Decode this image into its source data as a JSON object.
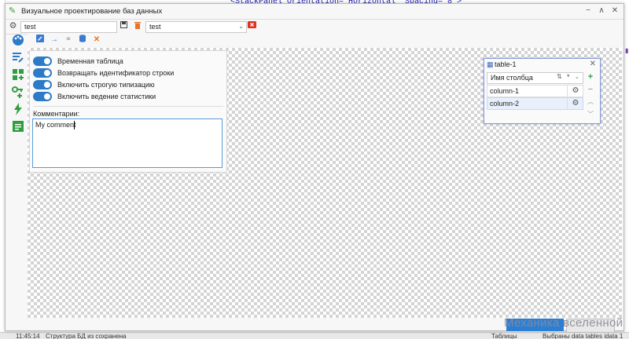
{
  "background": {
    "code_line": "<StackPanel Orientation=\"Horizontal\" Spacing=\"8\">",
    "watermark": "Механика вселенной",
    "status_time": "11:45:14",
    "status_text": "Структура БД из сохранена",
    "status_right_1": "Таблицы",
    "status_right_2": "Выбраны data tables idata 1"
  },
  "dialog": {
    "title": "Визуальное проектирование баз данных",
    "window_buttons": [
      "−",
      "∧",
      "✕"
    ]
  },
  "toolbar": {
    "project_value": "test",
    "schema_value": "test"
  },
  "properties": {
    "toggles": [
      {
        "label": "Временная таблица",
        "on": true
      },
      {
        "label": "Возвращать идентификатор строки",
        "on": true
      },
      {
        "label": "Включить строгую типизацию",
        "on": true
      },
      {
        "label": "Включить ведение статистики",
        "on": true
      }
    ],
    "comment_label": "Комментарии:",
    "comment_value": "My comment"
  },
  "table_window": {
    "title": "table-1",
    "column_header": "Имя столбца",
    "columns": [
      "column-1",
      "column-2"
    ]
  },
  "colors": {
    "accent": "#2b7bc9",
    "delete": "#e0301e",
    "add": "#2f9e3f",
    "warn": "#e8742a"
  },
  "icons": [
    "gear-icon",
    "save-icon",
    "trash-icon",
    "remove-icon",
    "edit-icon",
    "arrow-right-icon",
    "link-icon",
    "database-icon",
    "close-icon",
    "palette-icon",
    "list-edit-icon",
    "grid-add-icon",
    "key-add-icon",
    "lightning-icon",
    "comment-icon",
    "table-icon",
    "plus-icon",
    "minus-icon",
    "arrow-up-icon",
    "arrow-down-icon"
  ]
}
